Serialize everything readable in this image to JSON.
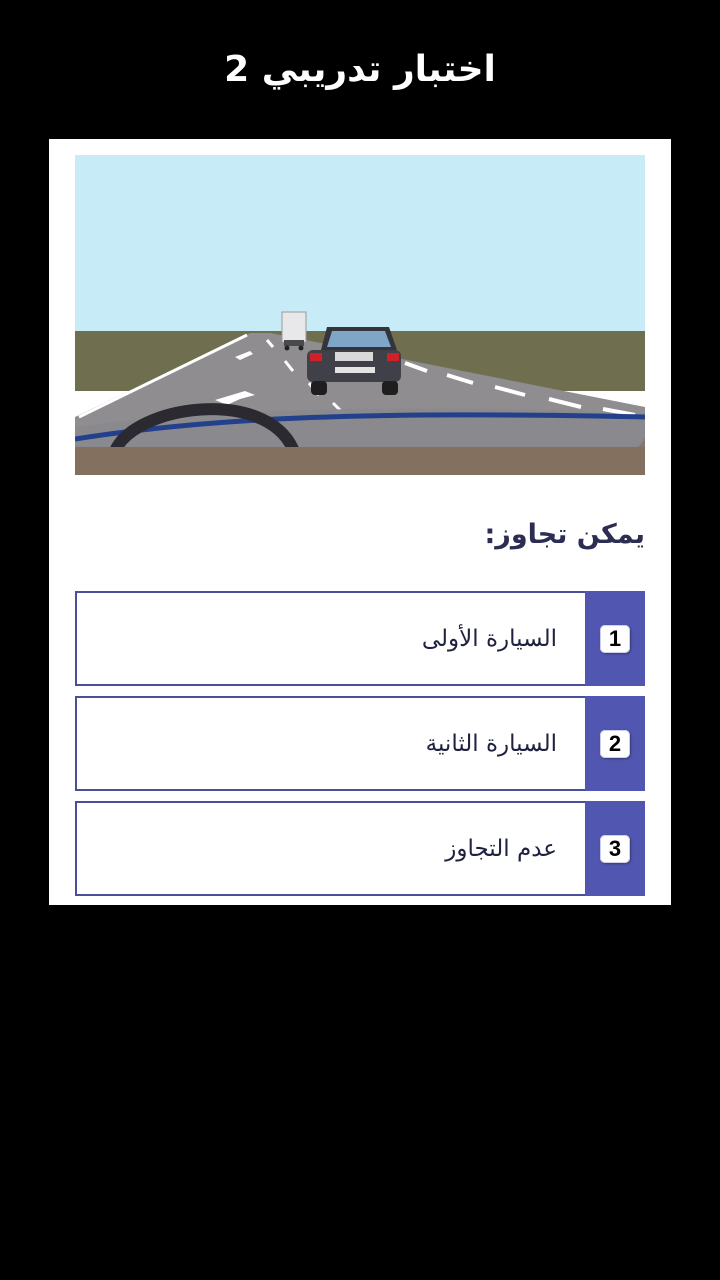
{
  "header": {
    "title": "اختبار تدريبي 2"
  },
  "question": {
    "text": "يمكن تجاوز:"
  },
  "scene": {
    "icon": "road-scene-illustration",
    "colors": {
      "sky": "#c8ecf7",
      "grass": "#6e6e4e",
      "road": "#8f8d90",
      "dashboard_stripe": "#23408c"
    }
  },
  "options": [
    {
      "number": "1",
      "label": "السيارة الأولى"
    },
    {
      "number": "2",
      "label": "السيارة الثانية"
    },
    {
      "number": "3",
      "label": "عدم التجاوز"
    }
  ],
  "colors": {
    "accent": "#5157b0",
    "border": "#4a4f9c",
    "background": "#000000"
  }
}
